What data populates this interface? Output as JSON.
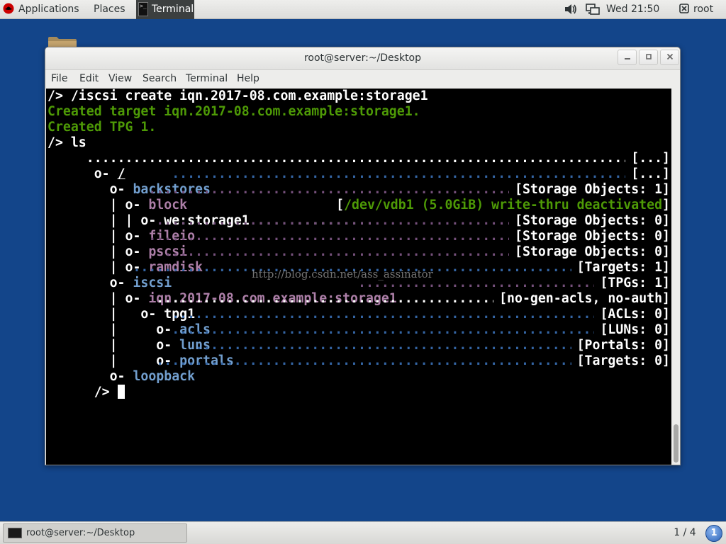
{
  "topbar": {
    "applications_label": "Applications",
    "places_label": "Places",
    "task_label": "Terminal",
    "clock": "Wed 21:50",
    "user": "root"
  },
  "window": {
    "title": "root@server:~/Desktop",
    "menus": [
      "File",
      "Edit",
      "View",
      "Search",
      "Terminal",
      "Help"
    ]
  },
  "terminal": {
    "prompt": "/>",
    "lines": {
      "cmd1": "/> /iscsi create iqn.2017-08.com.example:storage1",
      "out1": "Created target iqn.2017-08.com.example:storage1.",
      "out2": "Created TPG 1.",
      "cmd2": "/> ls"
    },
    "tree": {
      "root_prefix": "o- ",
      "root_name": "/",
      "root_status": "[...]",
      "backstores_prefix": "  o- ",
      "backstores_name": "backstores",
      "backstores_status": "[...]",
      "block_prefix": "  | o- ",
      "block_name": "block",
      "block_status": "[Storage Objects: 1]",
      "storage_prefix": "  | | o- ",
      "storage_name": "we:storage1",
      "storage_dots": " ............... ",
      "storage_status_open": "[",
      "storage_status_text": "/dev/vdb1 (5.0GiB) write-thru deactivated",
      "storage_status_close": "]",
      "fileio_prefix": "  | o- ",
      "fileio_name": "fileio",
      "fileio_status": "[Storage Objects: 0]",
      "pscsi_prefix": "  | o- ",
      "pscsi_name": "pscsi",
      "pscsi_status": "[Storage Objects: 0]",
      "ramdisk_prefix": "  | o- ",
      "ramdisk_name": "ramdisk",
      "ramdisk_status": "[Storage Objects: 0]",
      "iscsi_prefix": "  o- ",
      "iscsi_name": "iscsi",
      "iscsi_status": "[Targets: 1]",
      "iqn_prefix": "  | o- ",
      "iqn_name": "iqn.2017-08.com.example:storage1",
      "iqn_status": "[TPGs: 1]",
      "tpg_prefix": "  |   o- ",
      "tpg_name": "tpg1",
      "tpg_status": "[no-gen-acls, no-auth]",
      "acls_prefix": "  |     o- ",
      "acls_name": "acls",
      "acls_status": "[ACLs: 0]",
      "luns_prefix": "  |     o- ",
      "luns_name": "luns",
      "luns_status": "[LUNs: 0]",
      "portals_prefix": "  |     o- ",
      "portals_name": "portals",
      "portals_status": "[Portals: 0]",
      "loopback_prefix": "  o- ",
      "loopback_name": "loopback",
      "loopback_status": "[Targets: 0]"
    },
    "dots": " ...........................................................................................",
    "watermark": "http://blog.csdn.net/ass_assinator",
    "final_prompt": "/> "
  },
  "bottombar": {
    "window_item": "root@server:~/Desktop",
    "workspace": "1 / 4",
    "notification_count": "1"
  },
  "colors": {
    "desktop": "#13458a",
    "green": "#4e9a06",
    "blue": "#729fcf",
    "magenta": "#ad7fa8"
  }
}
